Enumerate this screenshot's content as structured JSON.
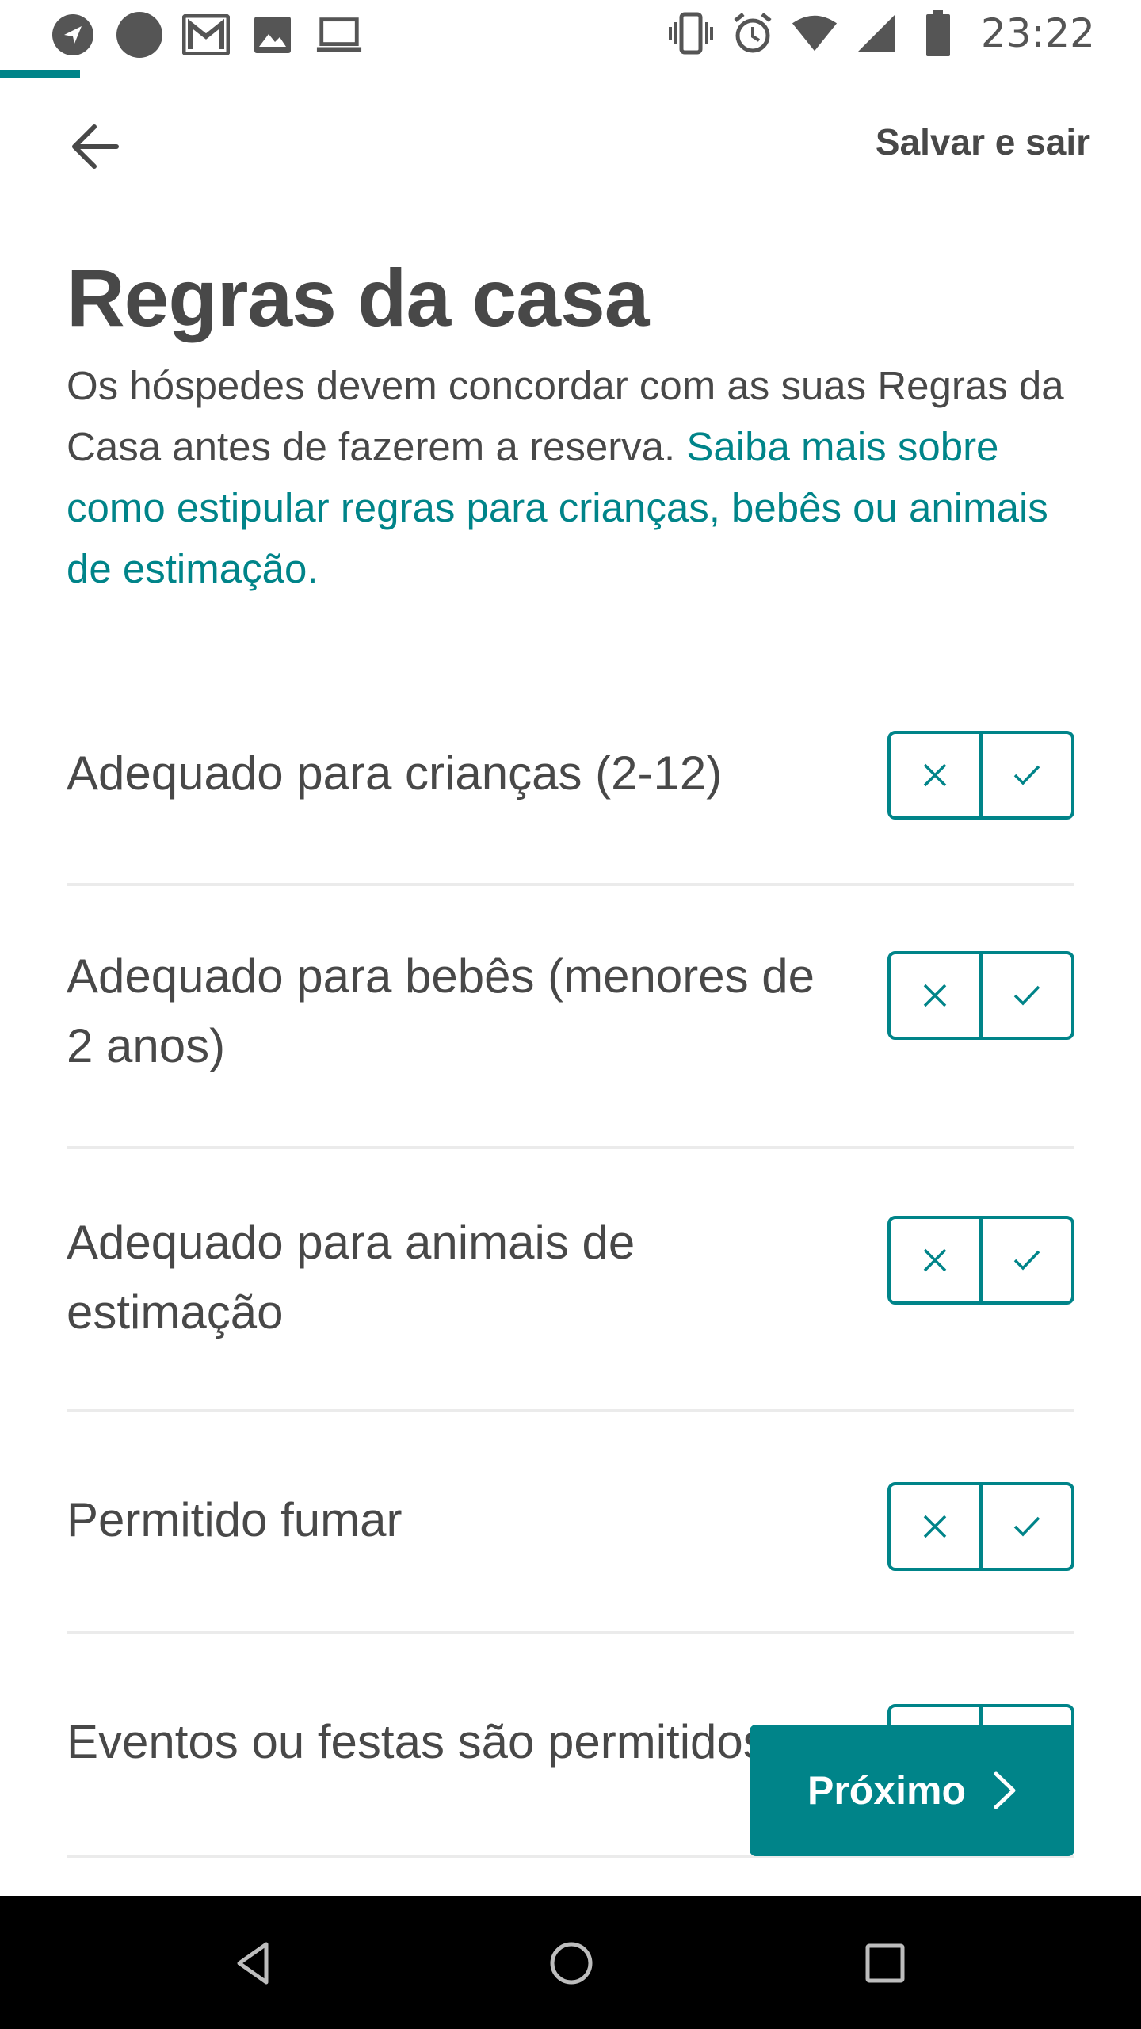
{
  "status_bar": {
    "time": "23:22",
    "left_icons": [
      "navigation-icon",
      "dot-icon",
      "gmail-icon",
      "image-icon",
      "laptop-icon"
    ],
    "right_icons": [
      "vibrate-icon",
      "alarm-icon",
      "wifi-icon",
      "signal-icon",
      "battery-icon"
    ]
  },
  "progress": {
    "fraction": 0.07,
    "color": "#008489"
  },
  "header": {
    "back_icon": "arrow-left-icon",
    "save_exit_label": "Salvar e sair"
  },
  "title": "Regras da casa",
  "intro": {
    "text": "Os hóspedes devem concordar com as suas Regras da Casa antes de fazerem a reserva. ",
    "link": "Saiba mais sobre como estipular regras para crianças, bebês ou animais de estimação."
  },
  "rules": [
    {
      "label": "Adequado para crianças (2-12)"
    },
    {
      "label": "Adequado para bebês (menores de 2 anos)"
    },
    {
      "label": "Adequado para animais de estimação"
    },
    {
      "label": "Permitido fumar"
    },
    {
      "label": "Eventos ou festas são permitidos"
    }
  ],
  "toggle_icons": {
    "no": "close-icon",
    "yes": "check-icon"
  },
  "next_button": {
    "label": "Próximo",
    "icon": "chevron-right-icon"
  },
  "nav_bar": {
    "icons": [
      "back-triangle-icon",
      "home-circle-icon",
      "recents-square-icon"
    ]
  },
  "colors": {
    "accent": "#008489",
    "text": "#484848",
    "divider": "#ebebeb"
  }
}
